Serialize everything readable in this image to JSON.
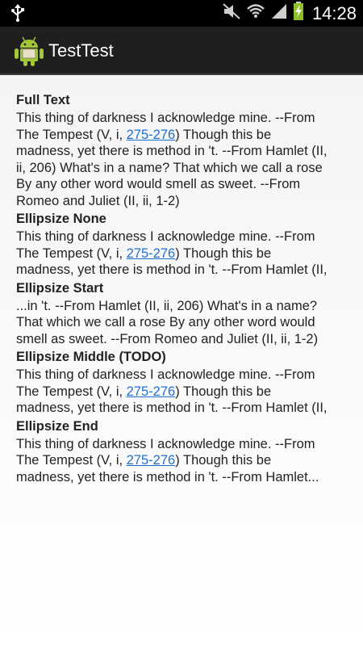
{
  "status_bar": {
    "time": "14:28",
    "icons": [
      "usb-icon",
      "mute-icon",
      "wifi-icon",
      "signal-icon",
      "battery-charging-icon"
    ]
  },
  "action_bar": {
    "title": "TestTest",
    "icon": "android-robot-icon"
  },
  "sections": [
    {
      "title": "Full Text",
      "lines": [
        {
          "parts": [
            {
              "text": "This thing of darkness I acknowledge mine. --From"
            }
          ]
        },
        {
          "parts": [
            {
              "text": "The Tempest (V, i, "
            },
            {
              "text": "275-276",
              "link": true
            },
            {
              "text": ") Though this be"
            }
          ]
        },
        {
          "parts": [
            {
              "text": "madness, yet there is method in 't. --From Hamlet (II,"
            }
          ]
        },
        {
          "parts": [
            {
              "text": "ii, 206) What's in a name? That which we call a rose"
            }
          ]
        },
        {
          "parts": [
            {
              "text": "By any other word would smell as sweet. --From"
            }
          ]
        },
        {
          "parts": [
            {
              "text": "Romeo and Juliet (II, ii, 1-2)"
            }
          ]
        }
      ]
    },
    {
      "title": "Ellipsize None",
      "lines": [
        {
          "parts": [
            {
              "text": "This thing of darkness I acknowledge mine. --From"
            }
          ]
        },
        {
          "parts": [
            {
              "text": "The Tempest (V, i, "
            },
            {
              "text": "275-276",
              "link": true
            },
            {
              "text": ") Though this be"
            }
          ]
        },
        {
          "parts": [
            {
              "text": "madness, yet there is method in 't. --From Hamlet (II,"
            }
          ]
        }
      ]
    },
    {
      "title": "Ellipsize Start",
      "lines": [
        {
          "parts": [
            {
              "text": "...in 't. --From Hamlet (II, ii, 206) What's in a name?"
            }
          ]
        },
        {
          "parts": [
            {
              "text": "That which we call a rose By any other word would"
            }
          ]
        },
        {
          "parts": [
            {
              "text": "smell as sweet. --From Romeo and Juliet (II, ii, 1-2)"
            }
          ]
        }
      ]
    },
    {
      "title": "Ellipsize Middle (TODO)",
      "lines": [
        {
          "parts": [
            {
              "text": "This thing of darkness I acknowledge mine. --From"
            }
          ]
        },
        {
          "parts": [
            {
              "text": "The Tempest (V, i, "
            },
            {
              "text": "275-276",
              "link": true
            },
            {
              "text": ") Though this be"
            }
          ]
        },
        {
          "parts": [
            {
              "text": "madness, yet there is method in 't. --From Hamlet (II,"
            }
          ]
        }
      ]
    },
    {
      "title": "Ellipsize End",
      "lines": [
        {
          "parts": [
            {
              "text": "This thing of darkness I acknowledge mine. --From"
            }
          ]
        },
        {
          "parts": [
            {
              "text": "The Tempest (V, i, "
            },
            {
              "text": "275-276",
              "link": true
            },
            {
              "text": ") Though this be"
            }
          ]
        },
        {
          "parts": [
            {
              "text": "madness, yet there is method in 't. --From Hamlet..."
            }
          ]
        }
      ]
    }
  ],
  "colors": {
    "link": "#1f6fd1",
    "text": "#222222",
    "action_bar": "#1f1f1f",
    "android_green": "#a4c639"
  }
}
